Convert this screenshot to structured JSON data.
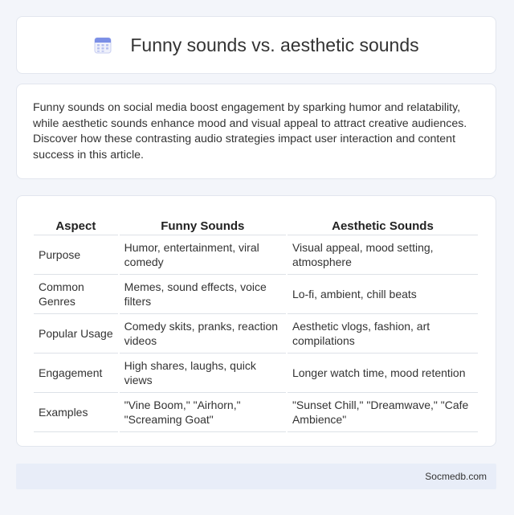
{
  "header": {
    "title": "Funny sounds vs. aesthetic sounds",
    "icon": "calendar-icon"
  },
  "intro": {
    "text": "Funny sounds on social media boost engagement by sparking humor and relatability, while aesthetic sounds enhance mood and visual appeal to attract creative audiences. Discover how these contrasting audio strategies impact user interaction and content success in this article."
  },
  "table": {
    "columns": [
      "Aspect",
      "Funny Sounds",
      "Aesthetic Sounds"
    ],
    "rows": [
      [
        "Purpose",
        "Humor, entertainment, viral comedy",
        "Visual appeal, mood setting, atmosphere"
      ],
      [
        "Common Genres",
        "Memes, sound effects, voice filters",
        "Lo-fi, ambient, chill beats"
      ],
      [
        "Popular Usage",
        "Comedy skits, pranks, reaction videos",
        "Aesthetic vlogs, fashion, art compilations"
      ],
      [
        "Engagement",
        "High shares, laughs, quick views",
        "Longer watch time, mood retention"
      ],
      [
        "Examples",
        "\"Vine Boom,\" \"Airhorn,\" \"Screaming Goat\"",
        "\"Sunset Chill,\" \"Dreamwave,\" \"Cafe Ambience\""
      ]
    ]
  },
  "footer": {
    "site": "Socmedb.com"
  },
  "colors": {
    "page_bg": "#f3f5fa",
    "card_bg": "#ffffff",
    "footer_bg": "#e8edf8",
    "icon_accent": "#7b8fe6"
  }
}
